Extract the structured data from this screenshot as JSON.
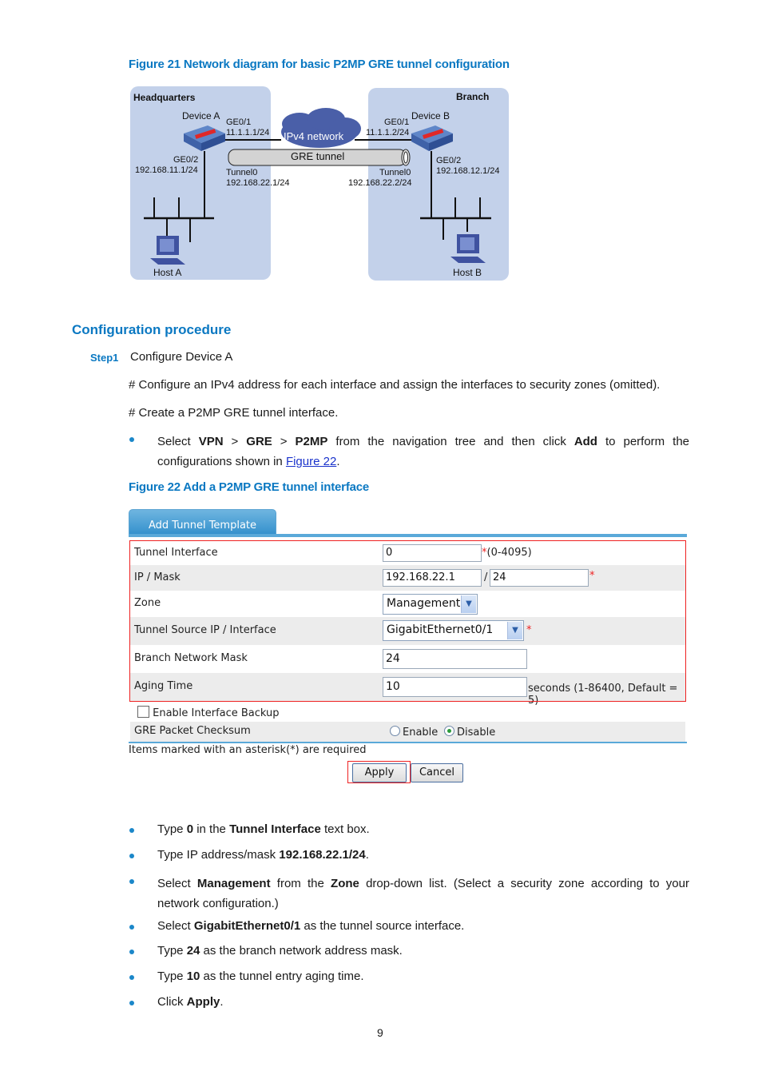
{
  "figure21": {
    "caption": "Figure 21 Network diagram for basic P2MP GRE tunnel configuration",
    "headquarters_label": "Headquarters",
    "branch_label": "Branch",
    "device_a": "Device A",
    "device_b": "Device B",
    "a_ge01": "GE0/1",
    "a_ge01_ip": "11.1.1.1/24",
    "a_ge02": "GE0/2",
    "a_ge02_ip": "192.168.11.1/24",
    "a_tunnel": "Tunnel0",
    "a_tunnel_ip": "192.168.22.1/24",
    "b_ge01": "GE0/1",
    "b_ge01_ip": "11.1.1.2/24",
    "b_ge02": "GE0/2",
    "b_ge02_ip": "192.168.12.1/24",
    "b_tunnel": "Tunnel0",
    "b_tunnel_ip": "192.168.22.2/24",
    "cloud_label": "IPv4 network",
    "tunnel_label": "GRE tunnel",
    "host_a": "Host A",
    "host_b": "Host B"
  },
  "section": {
    "heading": "Configuration procedure",
    "step_label": "Step1",
    "step_text": "Configure Device A",
    "para1": "# Configure an IPv4 address for each interface and assign the interfaces to security zones (omitted).",
    "para2": "# Create a P2MP GRE tunnel interface.",
    "nav_bullet": {
      "t1": "Select ",
      "b1": "VPN",
      "t2": " > ",
      "b2": "GRE",
      "t3": " > ",
      "b3": "P2MP",
      "t4": " from the navigation tree and then click ",
      "b4": "Add",
      "t5": " to perform the configurations shown in ",
      "link": "Figure 22",
      "t6": "."
    }
  },
  "figure22": {
    "caption": "Figure 22 Add a P2MP GRE tunnel interface",
    "tab_label": "Add Tunnel Template",
    "fields": {
      "tunnel_interface": {
        "label": "Tunnel Interface",
        "value": "0",
        "hint": "(0-4095)"
      },
      "ip_mask": {
        "label": "IP / Mask",
        "ip": "192.168.22.1",
        "separator": "/",
        "mask": "24"
      },
      "zone": {
        "label": "Zone",
        "selected": "Management"
      },
      "tunnel_source": {
        "label": "Tunnel Source IP / Interface",
        "selected": "GigabitEthernet0/1"
      },
      "branch_mask": {
        "label": "Branch Network Mask",
        "value": "24"
      },
      "aging_time": {
        "label": "Aging Time",
        "value": "10",
        "hint": "seconds (1-86400, Default = 5)"
      }
    },
    "asterisk": "*",
    "enable_backup_label": "Enable Interface Backup",
    "enable_backup_checked": false,
    "checksum": {
      "label": "GRE Packet Checksum",
      "options": [
        "Enable",
        "Disable"
      ],
      "selected": "Disable"
    },
    "required_note": "Items marked with an asterisk(*) are required",
    "apply_label": "Apply",
    "cancel_label": "Cancel"
  },
  "instructions": [
    {
      "t1": "Type ",
      "b1": "0",
      "t2": " in the ",
      "b2": "Tunnel Interface",
      "t3": " text box."
    },
    {
      "t1": "Type IP address/mask ",
      "b1": "192.168.22.1/24",
      "t2": "."
    },
    {
      "t1": "Select ",
      "b1": "Management",
      "t2": " from the ",
      "b2": "Zone",
      "t3": " drop-down list. (Select a security zone according to your network configuration.)"
    },
    {
      "t1": "Select ",
      "b1": "GigabitEthernet0/1",
      "t2": " as the tunnel source interface."
    },
    {
      "t1": "Type ",
      "b1": "24",
      "t2": " as the branch network address mask."
    },
    {
      "t1": "Type ",
      "b1": "10",
      "t2": " as the tunnel entry aging time."
    },
    {
      "t1": "Click ",
      "b1": "Apply",
      "t2": "."
    }
  ],
  "page_number": "9"
}
